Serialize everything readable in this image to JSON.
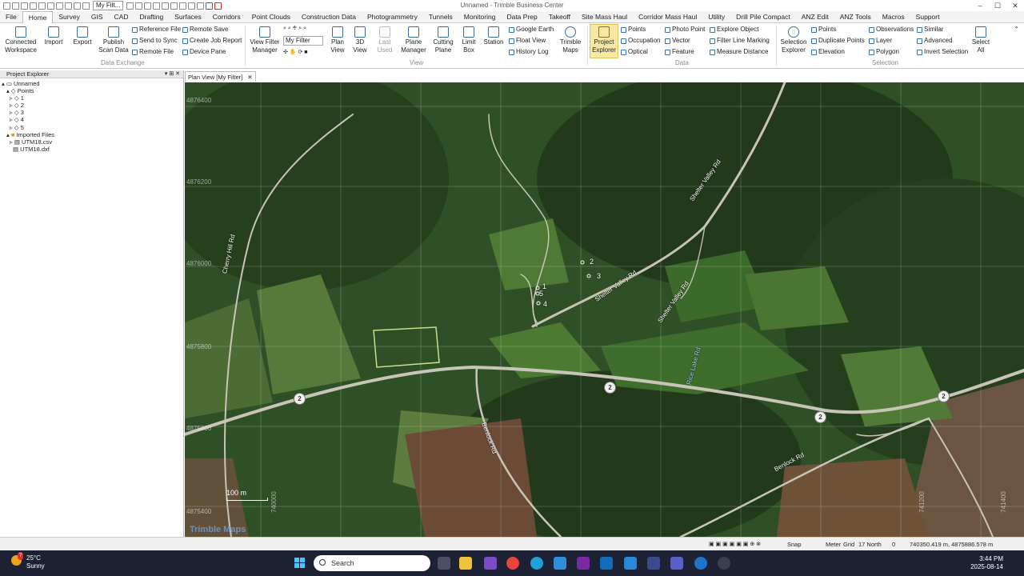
{
  "window": {
    "title": "Unnamed - Trimble Business Center",
    "filter_value": "My Filt...",
    "controls": [
      "–",
      "☐",
      "✕"
    ]
  },
  "tabs": [
    "File",
    "Home",
    "Survey",
    "GIS",
    "CAD",
    "Drafting",
    "Surfaces",
    "Corridors",
    "Point Clouds",
    "Construction Data",
    "Photogrammetry",
    "Tunnels",
    "Monitoring",
    "Data Prep",
    "Takeoff",
    "Site Mass Haul",
    "Corridor Mass Haul",
    "Utility",
    "Drill Pile Compact",
    "ANZ Edit",
    "ANZ Tools",
    "Macros",
    "Support"
  ],
  "ribbon": {
    "connected_workspace": [
      "Connected",
      "Workspace"
    ],
    "import": "Import",
    "export": "Export",
    "publish_scan_data": [
      "Publish",
      "Scan Data"
    ],
    "reference_file": "Reference File",
    "send_to_sync": "Send to Sync",
    "remote_file": "Remote File",
    "remote_save": "Remote Save",
    "create_job_report": "Create Job Report",
    "device_pane": "Device Pane",
    "group_data_exchange": "Data Exchange",
    "view_filter_manager": [
      "View Filter",
      "Manager"
    ],
    "my_filter": "My Filter",
    "plan_view": [
      "Plan",
      "View"
    ],
    "view_3d": [
      "3D",
      "View"
    ],
    "last_used": [
      "Last",
      "Used"
    ],
    "plane_manager": [
      "Plane",
      "Manager"
    ],
    "cutting_plane": [
      "Cutting",
      "Plane"
    ],
    "limit_box": [
      "Limit",
      "Box"
    ],
    "station": "Station",
    "google_earth": "Google Earth",
    "float_view": "Float View",
    "history_log": "History Log",
    "trimble_maps": [
      "Trimble",
      "Maps"
    ],
    "group_view": "View",
    "project_explorer": [
      "Project",
      "Explorer"
    ],
    "points": "Points",
    "occupation": "Occupation",
    "optical": "Optical",
    "photo_point": "Photo Point",
    "vector": "Vector",
    "feature": "Feature",
    "explore_object": "Explore Object",
    "filter_line_marking": "Filter Line Marking",
    "measure_distance": "Measure Distance",
    "group_data": "Data",
    "selection_explorer": [
      "Selection",
      "Explorer"
    ],
    "sel_points": "Points",
    "duplicate_points": "Duplicate Points",
    "elevation": "Elevation",
    "observations": "Observations",
    "layer": "Layer",
    "polygon": "Polygon",
    "similar": "Similar",
    "advanced": "Advanced",
    "invert_selection": "Invert Selection",
    "select_all": [
      "Select",
      "All"
    ],
    "group_selection": "Selection"
  },
  "project_explorer": {
    "title": "Project Explorer",
    "root": "Unnamed",
    "points_label": "Points",
    "points": [
      "1",
      "2",
      "3",
      "4",
      "5"
    ],
    "imported_files_label": "Imported Files",
    "files": [
      "UTM18.csv",
      "UTM18.dxf"
    ]
  },
  "document_tab": "Plan View [My Filter]",
  "map": {
    "northing_labels": [
      "4876400",
      "4876200",
      "4876000",
      "4875800",
      "4875600",
      "4875400"
    ],
    "easting_labels": [
      "740000",
      "741200",
      "741400"
    ],
    "roads": [
      "Cherry Hill Rd",
      "Shelter Valley Rd",
      "Shelter Valley Rd",
      "Benlock Rd",
      "Benlock Rd",
      "Shelter Valley Rd",
      "Rice Lake Rd"
    ],
    "route_number": "2",
    "point_labels": [
      "1",
      "2",
      "3",
      "4",
      "5"
    ],
    "scale": "100 m",
    "watermark": "Trimble Maps"
  },
  "status": {
    "snap": "Snap",
    "units": "Meter",
    "grid": "Grid",
    "north": "17 North",
    "zero": "0",
    "coordinates": "740350.419 m, 4875886.578 m"
  },
  "taskbar": {
    "temperature": "25°C",
    "condition": "Sunny",
    "badge": "7",
    "search_placeholder": "Search",
    "time": "3:44 PM",
    "date": "2025-08-14"
  },
  "colors": {
    "accent": "#2b579a",
    "highlight": "#f9e7a3",
    "taskbar": "#1c2233"
  }
}
